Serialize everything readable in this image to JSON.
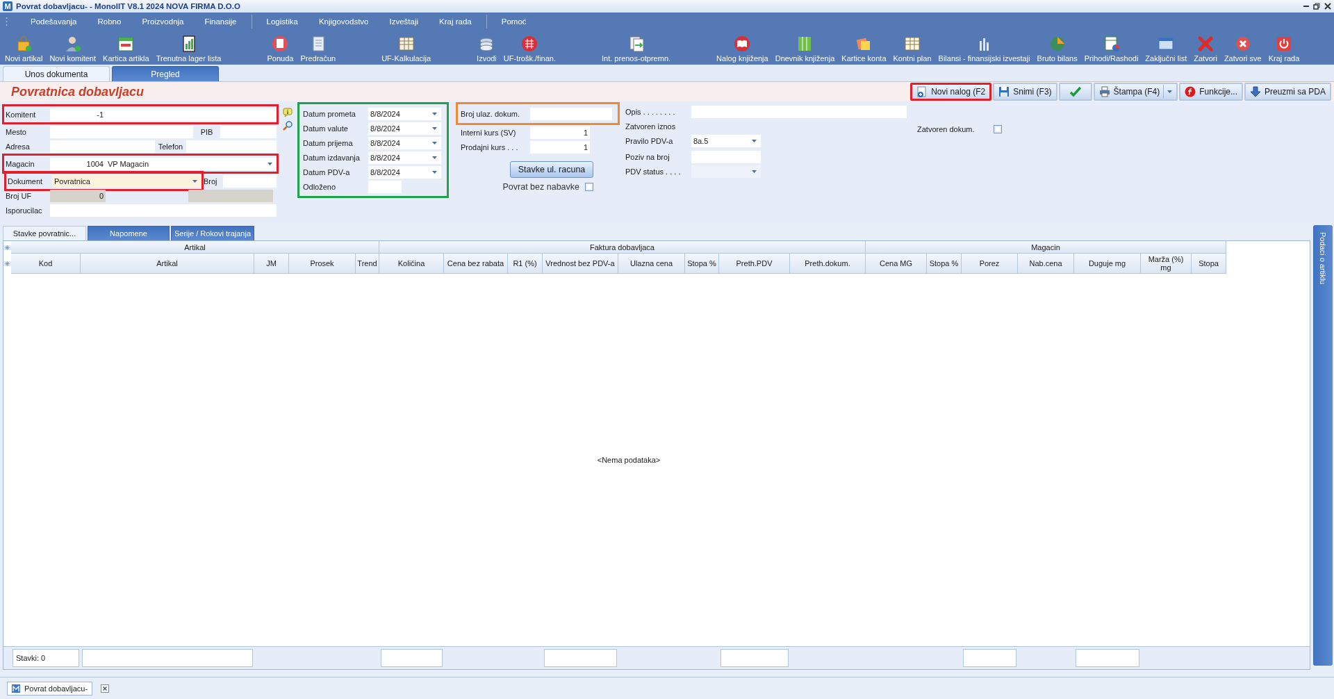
{
  "window": {
    "logo_letter": "M",
    "title": "Povrat dobavljacu- - MonolIT V8.1 2024 NOVA FIRMA D.O.O"
  },
  "menu": [
    {
      "items": [
        {
          "label": "Podešavanja"
        },
        {
          "label": "Robno"
        },
        {
          "label": "Proizvodnja"
        },
        {
          "label": "Finansije"
        }
      ]
    },
    {
      "items": [
        {
          "label": "Logistika"
        },
        {
          "label": "Knjigovodstvo"
        },
        {
          "label": "Izveštaji"
        },
        {
          "label": "Kraj rada"
        }
      ]
    },
    {
      "items": [
        {
          "label": "Pomoć"
        }
      ]
    }
  ],
  "toolbar": [
    {
      "items": [
        {
          "label": "Novi artikal"
        },
        {
          "label": "Novi komitent"
        },
        {
          "label": "Kartica artikla"
        },
        {
          "label": "Trenutna lager lista"
        }
      ]
    },
    {
      "items": [
        {
          "label": "Ponuda"
        },
        {
          "label": "Predračun"
        }
      ]
    },
    {
      "items": [
        {
          "label": "UF-Kalkulacija"
        }
      ]
    },
    {
      "items": [
        {
          "label": "Izvodi"
        },
        {
          "label": "UF-trošk./finan."
        }
      ]
    },
    {
      "items": [
        {
          "label": "Int. prenos-otpremn."
        }
      ]
    },
    {
      "items": [
        {
          "label": "Nalog knjiženja"
        },
        {
          "label": "Dnevnik knjiženja"
        },
        {
          "label": "Kartice konta"
        },
        {
          "label": "Kontni plan"
        },
        {
          "label": "Bilansi - finansijski izvestaji"
        },
        {
          "label": "Bruto bilans"
        },
        {
          "label": "Prihodi/Rashodi"
        },
        {
          "label": "Zaključni list"
        },
        {
          "label": "Zatvori"
        },
        {
          "label": "Zatvori sve"
        },
        {
          "label": "Kraj rada"
        }
      ]
    }
  ],
  "doc_tabs": [
    {
      "label": "Unos dokumenta",
      "selected": true
    },
    {
      "label": "Pregled",
      "selected": false
    }
  ],
  "form_title": "Povratnica dobavljacu",
  "actions": [
    {
      "kind": "button",
      "label": "Novi nalog (F2",
      "color": "#e0202c"
    },
    {
      "kind": "button",
      "label": "Snimi (F3)"
    },
    {
      "kind": "icon"
    },
    {
      "kind": "split",
      "label": "Štampa (F4)"
    },
    {
      "kind": "button",
      "label": "Funkcije..."
    },
    {
      "kind": "button",
      "label": "Preuzmi sa PDA"
    }
  ],
  "partner": {
    "label": "Komitent",
    "code": "-1",
    "color": "#e0202c"
  },
  "place": {
    "label": "Mesto"
  },
  "pib": {
    "label": "PIB"
  },
  "address": {
    "label": "Adresa"
  },
  "phone": {
    "label": "Telefon"
  },
  "warehouse": {
    "label": "Magacin",
    "code": "1004",
    "name": "VP Magacin",
    "color": "#e0202c"
  },
  "document": {
    "label": "Dokument",
    "value": "Povratnica",
    "color": "#e0202c"
  },
  "number": {
    "label": "Broj"
  },
  "invoice_no": {
    "label": "Broj UF",
    "value": "0"
  },
  "supplier": {
    "label": "Isporucilac"
  },
  "dates": {
    "color": "#1ea34a",
    "rows": [
      {
        "kind": "date",
        "label": "Datum prometa",
        "value": "8/8/2024"
      },
      {
        "kind": "date",
        "label": "Datum valute",
        "value": "8/8/2024"
      },
      {
        "kind": "date",
        "label": "Datum prijema",
        "value": "8/8/2024"
      },
      {
        "kind": "date",
        "label": "Datum izdavanja",
        "value": "8/8/2024"
      },
      {
        "kind": "date",
        "label": "Datum PDV-a",
        "value": "8/8/2024"
      },
      {
        "kind": "text",
        "label": "Odloženo"
      }
    ]
  },
  "entry_doc": {
    "label": "Broj ulaz. dokum.",
    "color": "#f08a30"
  },
  "rates": [
    {
      "label": "Interni kurs (SV)",
      "value": "1"
    },
    {
      "label": "Prodajni kurs . . .",
      "value": "1"
    }
  ],
  "items_button": "Stavke ul. racuna",
  "return_no_purchase": {
    "label": "Povrat bez nabavke",
    "checked": false
  },
  "extra": [
    {
      "kind": "wide",
      "label": "Opis . . . . . . . ."
    },
    {
      "kind": "none",
      "label": "Zatvoren iznos"
    },
    {
      "kind": "combo",
      "label": "Pravilo PDV-a",
      "value": "8a.5"
    },
    {
      "kind": "text",
      "label": "Poziv na broj"
    },
    {
      "kind": "disabled_combo",
      "label": "PDV status . . . ."
    }
  ],
  "closed_doc": {
    "label": "Zatvoren dokum.",
    "checked": false
  },
  "sub_tabs": [
    {
      "label": "Stavke  povratnic...",
      "selected": true
    },
    {
      "label": "Napomene",
      "selected": false
    },
    {
      "label": "Serije / Rokovi trajanja",
      "selected": false
    }
  ],
  "grid": {
    "groups": [
      {
        "label": "Artikal",
        "columns": [
          {
            "label": "Kod"
          },
          {
            "label": "Artikal"
          },
          {
            "label": "JM"
          },
          {
            "label": "Prosek"
          },
          {
            "label": "Trend"
          }
        ]
      },
      {
        "label": "Faktura dobavljaca",
        "columns": [
          {
            "label": "Količina"
          },
          {
            "label": "Cena bez rabata"
          },
          {
            "label": "R1 (%)"
          },
          {
            "label": "Vrednost bez PDV-a"
          },
          {
            "label": "Ulazna cena"
          },
          {
            "label": "Stopa %"
          },
          {
            "label": "Preth.PDV"
          },
          {
            "label": "Preth.dokum."
          }
        ]
      },
      {
        "label": "Magacin",
        "columns": [
          {
            "label": "Cena MG"
          },
          {
            "label": "Stopa %"
          },
          {
            "label": "Porez"
          },
          {
            "label": "Nab.cena"
          },
          {
            "label": "Duguje mg"
          },
          {
            "label": "Marža (%) mg"
          },
          {
            "label": "Stopa"
          }
        ]
      }
    ],
    "empty_text": "<Nema podataka>",
    "footer_cells": [
      {
        "kind": "label",
        "text": "Stavki: 0"
      },
      {
        "kind": "box"
      },
      {
        "kind": "blank"
      },
      {
        "kind": "blank"
      },
      {
        "kind": "blank"
      },
      {
        "kind": "box"
      },
      {
        "kind": "blank"
      },
      {
        "kind": "blank"
      },
      {
        "kind": "box"
      },
      {
        "kind": "blank"
      },
      {
        "kind": "blank"
      },
      {
        "kind": "box"
      },
      {
        "kind": "blank"
      },
      {
        "kind": "blank"
      },
      {
        "kind": "blank"
      },
      {
        "kind": "box"
      },
      {
        "kind": "blank"
      },
      {
        "kind": "box"
      },
      {
        "kind": "blank"
      },
      {
        "kind": "blank"
      }
    ]
  },
  "side_panel": {
    "label": "Podaci o artiklu"
  },
  "taskbar": [
    {
      "label": "Povrat dobavljacu-",
      "selected": true
    }
  ]
}
